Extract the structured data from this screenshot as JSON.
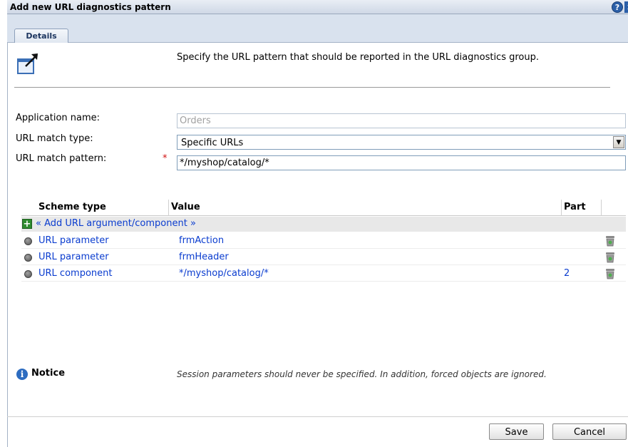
{
  "dialog": {
    "title": "Add new URL diagnostics pattern",
    "help_icon": "?",
    "close_icon": "x"
  },
  "tabs": [
    {
      "label": "Details",
      "selected": true
    }
  ],
  "description": "Specify the URL pattern that should be reported in the URL diagnostics group.",
  "form": {
    "application_name_label": "Application name:",
    "application_name_value": "Orders",
    "match_type_label": "URL match type:",
    "match_type_value": "Specific URLs",
    "match_pattern_label": "URL match pattern:",
    "match_pattern_required": "*",
    "match_pattern_value": "*/myshop/catalog/*"
  },
  "table": {
    "headers": {
      "scheme_type": "Scheme type",
      "value": "Value",
      "part": "Part"
    },
    "add_link": "« Add URL argument/component »",
    "rows": [
      {
        "scheme_type": "URL parameter",
        "value": "frmAction",
        "part": ""
      },
      {
        "scheme_type": "URL parameter",
        "value": "frmHeader",
        "part": ""
      },
      {
        "scheme_type": "URL component",
        "value": "*/myshop/catalog/*",
        "part": "2"
      }
    ]
  },
  "notice": {
    "label": "Notice",
    "text": "Session parameters should never be specified. In addition, forced objects are ignored."
  },
  "buttons": {
    "save": "Save",
    "cancel": "Cancel"
  },
  "colors": {
    "link": "#0a3ccf",
    "required": "#d01010",
    "header_bg": "#d9e2ee"
  }
}
